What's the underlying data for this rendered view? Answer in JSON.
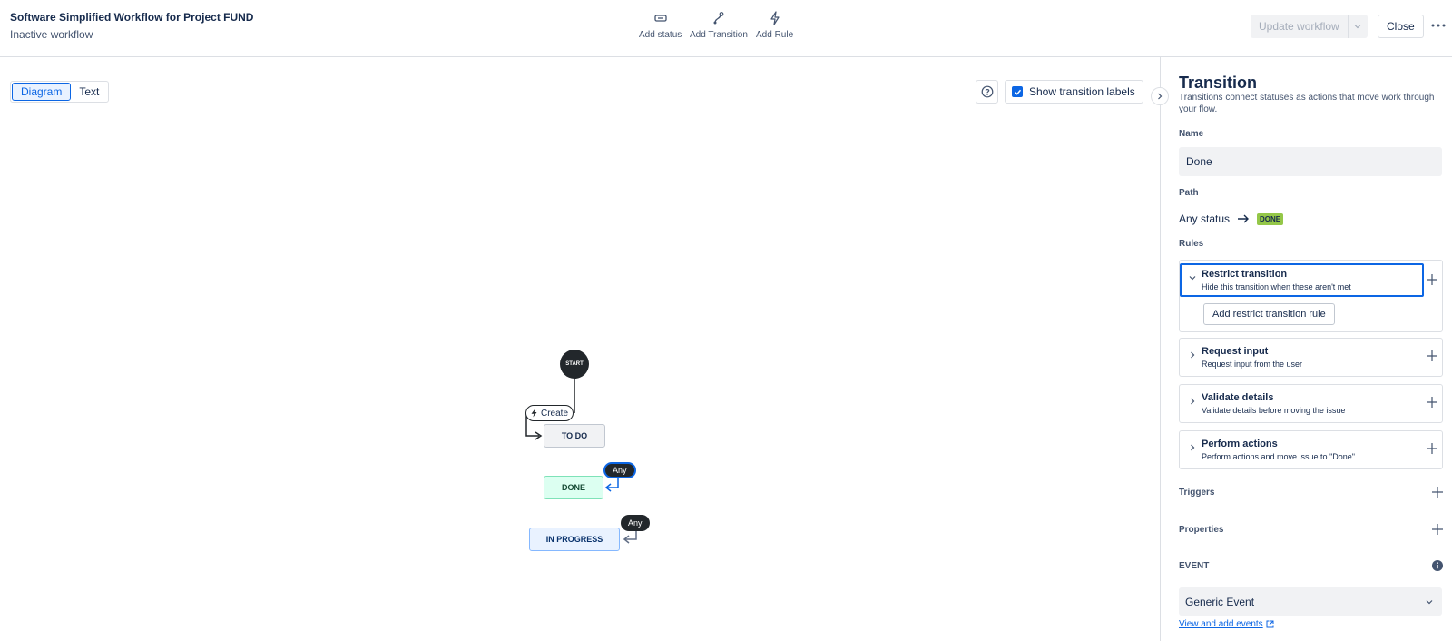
{
  "header": {
    "title": "Software Simplified Workflow for Project FUND",
    "subtitle": "Inactive workflow",
    "tools": {
      "add_status": "Add status",
      "add_transition": "Add Transition",
      "add_rule": "Add Rule"
    },
    "update_label": "Update workflow",
    "close_label": "Close"
  },
  "canvas": {
    "view_tabs": {
      "diagram": "Diagram",
      "text": "Text"
    },
    "active_view": "Diagram",
    "show_labels_text": "Show transition labels",
    "show_labels_checked": true
  },
  "diagram": {
    "start_label": "START",
    "create_label": "Create",
    "statuses": {
      "todo": "TO DO",
      "done": "DONE",
      "in_progress": "IN PROGRESS"
    },
    "any_label": "Any",
    "colors": {
      "todo": "#f1f2f4",
      "done": "#dcfff1",
      "in_progress": "#e9f2ff",
      "selection": "#0c66e4"
    }
  },
  "panel": {
    "title": "Transition",
    "description": "Transitions connect statuses as actions that move work through your flow.",
    "name_label": "Name",
    "name_value": "Done",
    "path_label": "Path",
    "path_from": "Any status",
    "path_to": "DONE",
    "rules_label": "Rules",
    "rules": [
      {
        "title": "Restrict transition",
        "subtitle": "Hide this transition when these aren't met",
        "button": "Add restrict transition rule"
      },
      {
        "title": "Request input",
        "subtitle": "Request input from the user"
      },
      {
        "title": "Validate details",
        "subtitle": "Validate details before moving the issue"
      },
      {
        "title": "Perform actions",
        "subtitle": "Perform actions and move issue to \"Done\""
      }
    ],
    "triggers_label": "Triggers",
    "properties_label": "Properties",
    "event_label": "EVENT",
    "event_value": "Generic Event",
    "events_link": "View and add events"
  }
}
